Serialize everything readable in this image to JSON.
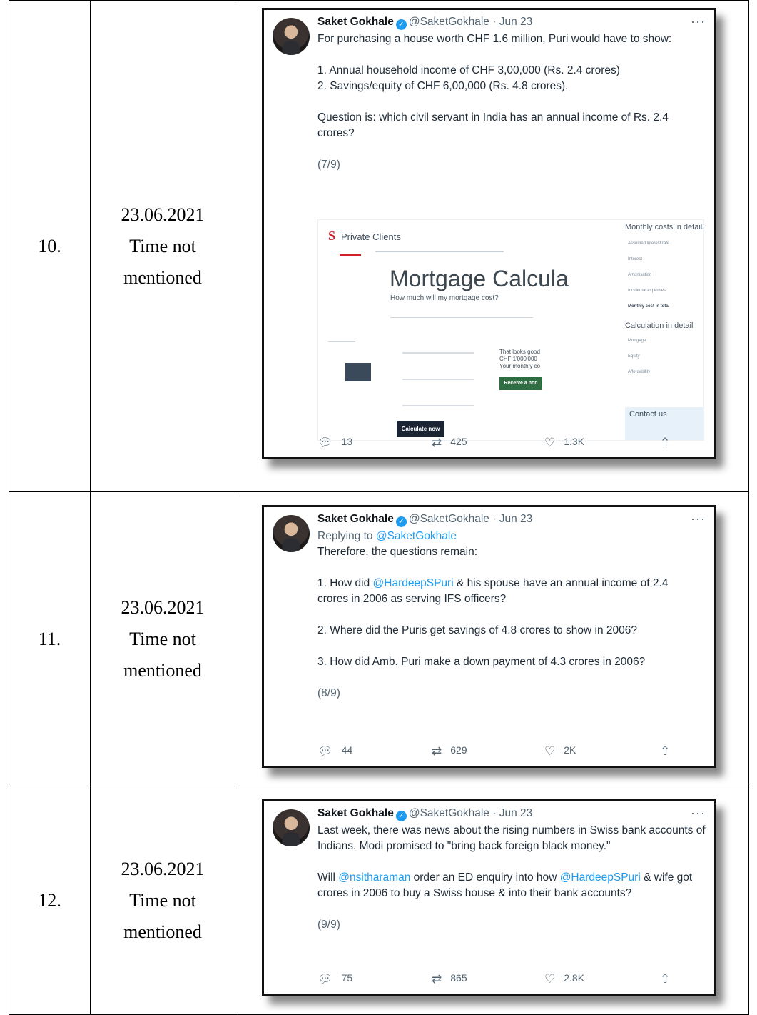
{
  "rows": [
    {
      "num": "10.",
      "date": "23.06.2021",
      "time": "Time not mentioned",
      "tweet": {
        "name": "Saket Gokhale",
        "handle": "@SaketGokhale · Jun 23",
        "lines": [
          "For purchasing a house worth CHF 1.6 million, Puri would have to show:",
          "",
          "1. Annual household income of CHF 3,00,000 (Rs. 2.4 crores)",
          "2. Savings/equity of CHF 6,00,000 (Rs. 4.8 crores).",
          "",
          "Question is: which civil servant in India has an annual income of Rs. 2.4 crores?",
          "",
          "(7/9)"
        ],
        "replies": "13",
        "retweets": "425",
        "likes": "1.3K",
        "embedded": {
          "brand": "Private Clients",
          "title": "Mortgage Calcula",
          "subtitle": "How much will my mortgage cost?",
          "button": "Calculate now",
          "side_button": "Receive a non",
          "side_text_1": "That looks good",
          "side_text_2": "CHF 1'000'000",
          "side_text_3": "Your monthly co",
          "right_heading_1": "Monthly costs in details",
          "right_labels_1": [
            "Assumed interest rate",
            "Interest",
            "Amortisation",
            "Incidental expenses",
            "Monthly cost in total"
          ],
          "right_heading_2": "Calculation in detail",
          "right_labels_2": [
            "Mortgage",
            "Equity",
            "Affordability"
          ],
          "contact": "Contact us"
        }
      }
    },
    {
      "num": "11.",
      "date": "23.06.2021",
      "time": "Time not mentioned",
      "tweet": {
        "name": "Saket Gokhale",
        "handle": "@SaketGokhale · Jun 23",
        "replying_prefix": "Replying to ",
        "replying_to": "@SaketGokhale",
        "intro": "Therefore, the questions remain:",
        "q1_prefix": "1. How did ",
        "q1_mention": "@HardeepSPuri",
        "q1_rest": " & his spouse have an annual income of 2.4 crores in 2006 as serving IFS officers?",
        "q2": "2. Where did the Puris get savings of 4.8 crores to show in 2006?",
        "q3": "3. How did Amb. Puri make a down payment of 4.3 crores in 2006?",
        "count": "(8/9)",
        "replies": "44",
        "retweets": "629",
        "likes": "2K"
      }
    },
    {
      "num": "12.",
      "date": "23.06.2021",
      "time": "Time not mentioned",
      "tweet": {
        "name": "Saket Gokhale",
        "handle": "@SaketGokhale · Jun 23",
        "para1": "Last week, there was news about the rising numbers in Swiss bank accounts of Indians. Modi promised to \"bring back foreign black money.\"",
        "p2_a": "Will ",
        "p2_m1": "@nsitharaman",
        "p2_b": " order an ED enquiry into how ",
        "p2_m2": "@HardeepSPuri",
        "p2_c": " & wife got crores in 2006 to buy a Swiss house & into their bank accounts?",
        "count": "(9/9)",
        "replies": "75",
        "retweets": "865",
        "likes": "2.8K"
      }
    }
  ],
  "icons": [
    "reply-icon",
    "retweet-icon",
    "like-icon",
    "share-icon",
    "more-icon",
    "verified-badge-icon"
  ]
}
